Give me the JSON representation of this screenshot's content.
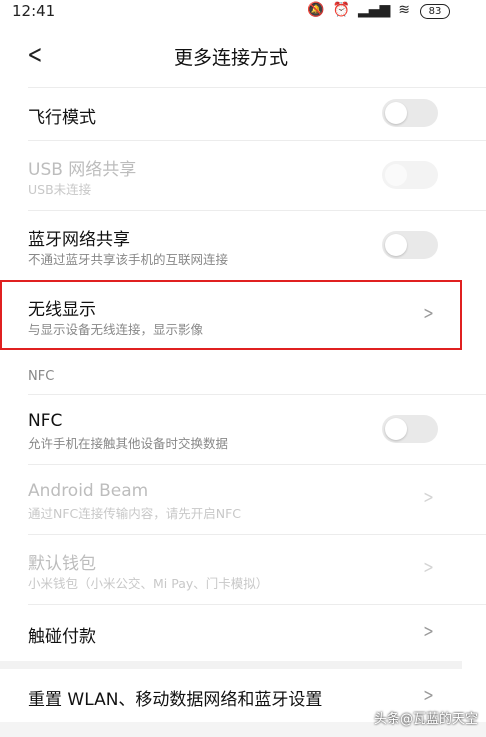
{
  "status": {
    "time": "12:41",
    "battery": "83",
    "icons": [
      "mute-icon",
      "alarm-icon",
      "signal-icon",
      "wifi-icon",
      "battery-icon"
    ]
  },
  "header": {
    "title": "更多连接方式",
    "back_icon": "chevron-left-icon"
  },
  "rows": {
    "airplane": {
      "label": "飞行模式",
      "toggle": "off"
    },
    "usb": {
      "label": "USB 网络共享",
      "sub": "USB未连接",
      "toggle": "off",
      "disabled": true
    },
    "bluetooth": {
      "label": "蓝牙网络共享",
      "sub": "不通过蓝牙共享该手机的互联网连接",
      "toggle": "off"
    },
    "wireless": {
      "label": "无线显示",
      "sub": "与显示设备无线连接，显示影像"
    },
    "nfc_section": "NFC",
    "nfc": {
      "label": "NFC",
      "sub": "允许手机在接触其他设备时交换数据",
      "toggle": "off"
    },
    "beam": {
      "label": "Android Beam",
      "sub": "通过NFC连接传输内容，请先开启NFC",
      "disabled": true
    },
    "wallet": {
      "label": "默认钱包",
      "sub": "小米钱包（小米公交、Mi Pay、门卡模拟）",
      "disabled": true
    },
    "touchpay": {
      "label": "触碰付款"
    },
    "reset": {
      "label": "重置 WLAN、移动数据网络和蓝牙设置"
    }
  },
  "watermark": "头条@瓦蓝的天空",
  "colors": {
    "highlight": "#e02020",
    "toggle_off": "#e9e9e9"
  }
}
